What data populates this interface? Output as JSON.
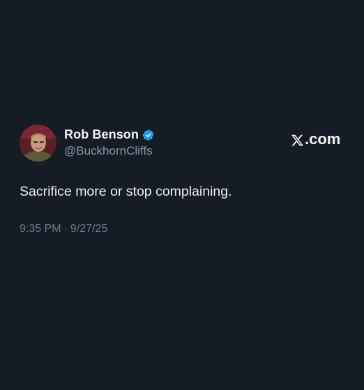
{
  "author": {
    "name": "Rob Benson",
    "handle": "@BuckhornCliffs",
    "verified": true,
    "avatar_icon": "avatar-photo"
  },
  "brand": {
    "label": ".com",
    "icon": "x-logo-icon"
  },
  "tweet": {
    "text": "Sacrifice more or stop complaining.",
    "time": "9:35 PM",
    "separator": "·",
    "date": "9/27/25"
  },
  "colors": {
    "background": "#151c25",
    "verified_badge": "#1d9bf0",
    "secondary_text": "#8b98a5",
    "meta_text": "#6f7c88"
  }
}
